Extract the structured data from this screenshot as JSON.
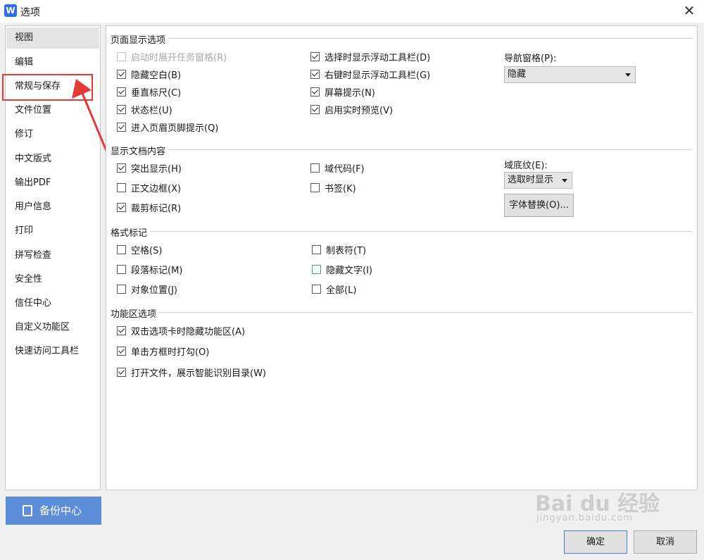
{
  "window": {
    "title": "选项",
    "app_icon_letter": "W",
    "close_label": "✕"
  },
  "sidebar": {
    "items": [
      {
        "label": "视图",
        "selected": true
      },
      {
        "label": "编辑"
      },
      {
        "label": "常规与保存"
      },
      {
        "label": "文件位置"
      },
      {
        "label": "修订"
      },
      {
        "label": "中文版式"
      },
      {
        "label": "输出PDF"
      },
      {
        "label": "用户信息"
      },
      {
        "label": "打印"
      },
      {
        "label": "拼写检查"
      },
      {
        "label": "安全性"
      },
      {
        "label": "信任中心"
      },
      {
        "label": "自定义功能区"
      },
      {
        "label": "快速访问工具栏"
      }
    ],
    "backup_label": "备份中心"
  },
  "sections": {
    "page_display": {
      "title": "页面显示选项",
      "col1": [
        {
          "label": "启动时展开任务窗格(R)",
          "checked": false,
          "disabled": true
        },
        {
          "label": "隐藏空白(B)",
          "checked": true
        },
        {
          "label": "垂直标尺(C)",
          "checked": true
        },
        {
          "label": "状态栏(U)",
          "checked": true
        },
        {
          "label": "进入页眉页脚提示(Q)",
          "checked": true
        }
      ],
      "col2": [
        {
          "label": "选择时显示浮动工具栏(D)",
          "checked": true
        },
        {
          "label": "右键时显示浮动工具栏(G)",
          "checked": true
        },
        {
          "label": "屏幕提示(N)",
          "checked": true
        },
        {
          "label": "启用实时预览(V)",
          "checked": true
        }
      ],
      "nav_pane_label": "导航窗格(P):",
      "nav_pane_value": "隐藏"
    },
    "doc_content": {
      "title": "显示文档内容",
      "col1": [
        {
          "label": "突出显示(H)",
          "checked": true
        },
        {
          "label": "正文边框(X)",
          "checked": false
        },
        {
          "label": "裁剪标记(R)",
          "checked": true
        }
      ],
      "col2": [
        {
          "label": "域代码(F)",
          "checked": false
        },
        {
          "label": "书签(K)",
          "checked": false
        }
      ],
      "field_shading_label": "域底纹(E):",
      "field_shading_value": "选取时显示",
      "font_replace_label": "字体替换(O)..."
    },
    "format_marks": {
      "title": "格式标记",
      "col1": [
        {
          "label": "空格(S)",
          "checked": false
        },
        {
          "label": "段落标记(M)",
          "checked": false
        },
        {
          "label": "对象位置(J)",
          "checked": false
        }
      ],
      "col2": [
        {
          "label": "制表符(T)",
          "checked": false
        },
        {
          "label": "隐藏文字(I)",
          "checked": false
        },
        {
          "label": "全部(L)",
          "checked": false
        }
      ]
    },
    "ribbon": {
      "title": "功能区选项",
      "col1": [
        {
          "label": "双击选项卡时隐藏功能区(A)",
          "checked": true
        },
        {
          "label": "单击方框时打勾(O)",
          "checked": true
        },
        {
          "label": "打开文件，展示智能识别目录(W)",
          "checked": true
        }
      ]
    }
  },
  "footer": {
    "ok_label": "确定",
    "cancel_label": "取消"
  },
  "watermark": {
    "text": "Bai du 经验",
    "sub": "jingyan.baidu.com"
  },
  "colors": {
    "accent": "#5b8dd9",
    "annotation": "#e53935"
  }
}
